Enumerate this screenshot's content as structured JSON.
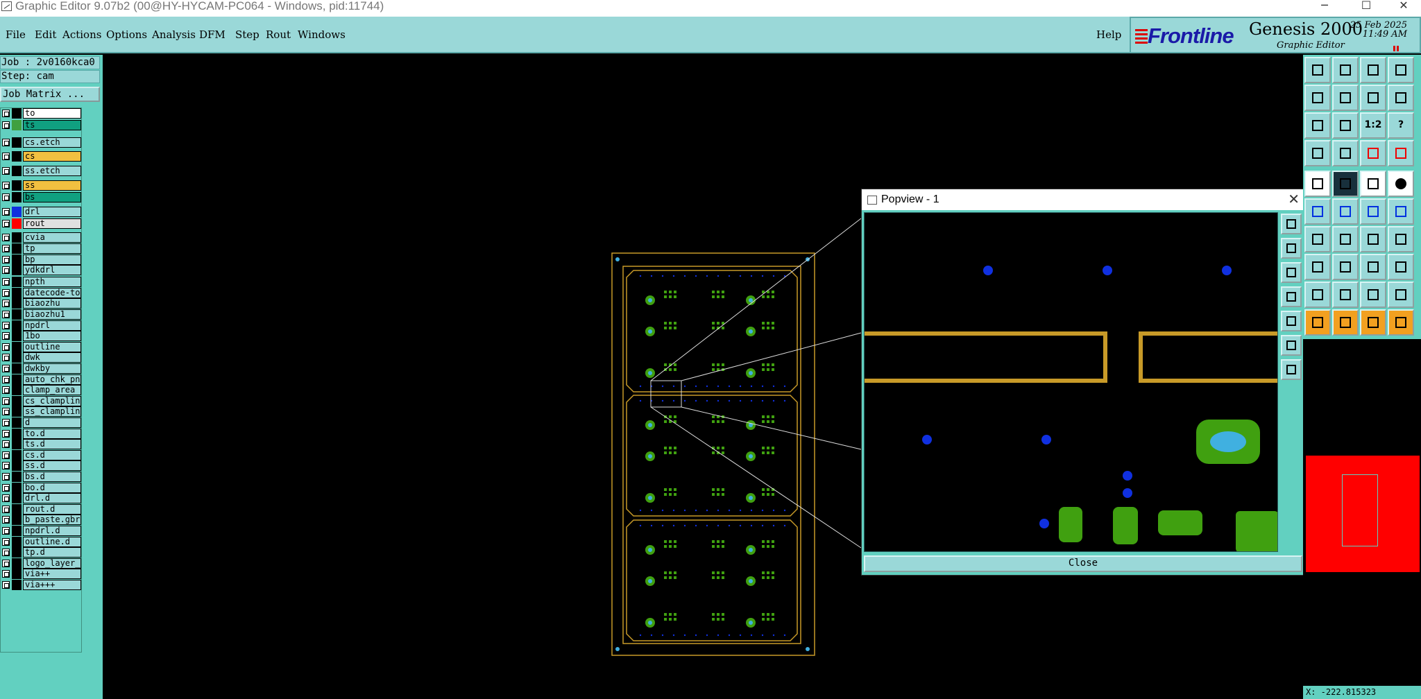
{
  "window": {
    "title": "Graphic Editor 9.07b2 (00@HY-HYCAM-PC064 - Windows, pid:11744)",
    "minimize": "─",
    "maximize": "☐",
    "close": "✕"
  },
  "menu": {
    "items": [
      "File",
      "Edit",
      "Actions",
      "Options",
      "Analysis",
      "DFM",
      "Step",
      "Rout",
      "Windows"
    ],
    "help": "Help"
  },
  "brand": {
    "logo": "Frontline",
    "product": "Genesis 2000",
    "subtitle": "Graphic Editor",
    "date": "25 Feb 2025",
    "time": "11:49 AM"
  },
  "job": {
    "job_label": "Job : 2v0160kca0",
    "step_label": "Step: cam",
    "matrix_button": "Job Matrix ..."
  },
  "layers": [
    {
      "name": "to",
      "swatch": "#000000",
      "fill": "#ffffff"
    },
    {
      "name": "ts",
      "swatch": "#40a040",
      "fill": "#10a080"
    },
    {
      "name": "cs.etch",
      "swatch": "#000000",
      "fill": "#9ad8d8"
    },
    {
      "name": "cs",
      "swatch": "#000000",
      "fill": "#f2c040"
    },
    {
      "name": "ss.etch",
      "swatch": "#000000",
      "fill": "#9ad8d8"
    },
    {
      "name": "ss",
      "swatch": "#000000",
      "fill": "#f2c040"
    },
    {
      "name": "bs",
      "swatch": "#000000",
      "fill": "#10a080"
    },
    {
      "name": "drl",
      "swatch": "#1030e0",
      "fill": "#9ad8d8"
    },
    {
      "name": "rout",
      "swatch": "#ff0000",
      "fill": "#e0e0e0"
    },
    {
      "name": "cvia",
      "swatch": "#000000",
      "fill": "#9ad8d8"
    },
    {
      "name": "tp",
      "swatch": "#000000",
      "fill": "#9ad8d8"
    },
    {
      "name": "bp",
      "swatch": "#000000",
      "fill": "#9ad8d8"
    },
    {
      "name": "ydkdrl",
      "swatch": "#000000",
      "fill": "#9ad8d8"
    },
    {
      "name": "npth",
      "swatch": "#000000",
      "fill": "#9ad8d8"
    },
    {
      "name": "datecode-to",
      "swatch": "#000000",
      "fill": "#9ad8d8"
    },
    {
      "name": "biaozhu",
      "swatch": "#000000",
      "fill": "#9ad8d8"
    },
    {
      "name": "biaozhu1",
      "swatch": "#000000",
      "fill": "#9ad8d8"
    },
    {
      "name": "npdrl",
      "swatch": "#000000",
      "fill": "#9ad8d8"
    },
    {
      "name": "1bo",
      "swatch": "#000000",
      "fill": "#9ad8d8"
    },
    {
      "name": "outline",
      "swatch": "#000000",
      "fill": "#9ad8d8"
    },
    {
      "name": "dwk",
      "swatch": "#000000",
      "fill": "#9ad8d8"
    },
    {
      "name": "dwkby",
      "swatch": "#000000",
      "fill": "#9ad8d8"
    },
    {
      "name": "auto_chk_pn",
      "swatch": "#000000",
      "fill": "#9ad8d8"
    },
    {
      "name": "clamp_area",
      "swatch": "#000000",
      "fill": "#9ad8d8"
    },
    {
      "name": "cs_clampline",
      "swatch": "#000000",
      "fill": "#9ad8d8"
    },
    {
      "name": "ss_clampline",
      "swatch": "#000000",
      "fill": "#9ad8d8"
    },
    {
      "name": "d",
      "swatch": "#000000",
      "fill": "#9ad8d8"
    },
    {
      "name": "to.d",
      "swatch": "#000000",
      "fill": "#9ad8d8"
    },
    {
      "name": "ts.d",
      "swatch": "#000000",
      "fill": "#9ad8d8"
    },
    {
      "name": "cs.d",
      "swatch": "#000000",
      "fill": "#9ad8d8"
    },
    {
      "name": "ss.d",
      "swatch": "#000000",
      "fill": "#9ad8d8"
    },
    {
      "name": "bs.d",
      "swatch": "#000000",
      "fill": "#9ad8d8"
    },
    {
      "name": "bo.d",
      "swatch": "#000000",
      "fill": "#9ad8d8"
    },
    {
      "name": "drl.d",
      "swatch": "#000000",
      "fill": "#9ad8d8"
    },
    {
      "name": "rout.d",
      "swatch": "#000000",
      "fill": "#9ad8d8"
    },
    {
      "name": "b_paste.gbr",
      "swatch": "#000000",
      "fill": "#9ad8d8"
    },
    {
      "name": "npdrl.d",
      "swatch": "#000000",
      "fill": "#9ad8d8"
    },
    {
      "name": "outline.d",
      "swatch": "#000000",
      "fill": "#9ad8d8"
    },
    {
      "name": "tp.d",
      "swatch": "#000000",
      "fill": "#9ad8d8"
    },
    {
      "name": "logo_layer_t",
      "swatch": "#000000",
      "fill": "#9ad8d8"
    },
    {
      "name": "via++",
      "swatch": "#000000",
      "fill": "#9ad8d8"
    },
    {
      "name": "via+++",
      "swatch": "#000000",
      "fill": "#9ad8d8"
    }
  ],
  "popview": {
    "title": "Popview - 1",
    "close_x": "✕",
    "close_button": "Close"
  },
  "tools": {
    "scale_label": "1:2",
    "help_label": "?"
  },
  "status": {
    "coords": "X: -222.815323"
  },
  "colors": {
    "panel": "#62d0c0",
    "button": "#9ad8d8",
    "copper_outline": "#c89a28",
    "pad_green": "#40a010",
    "drill_blue": "#1030e0"
  }
}
